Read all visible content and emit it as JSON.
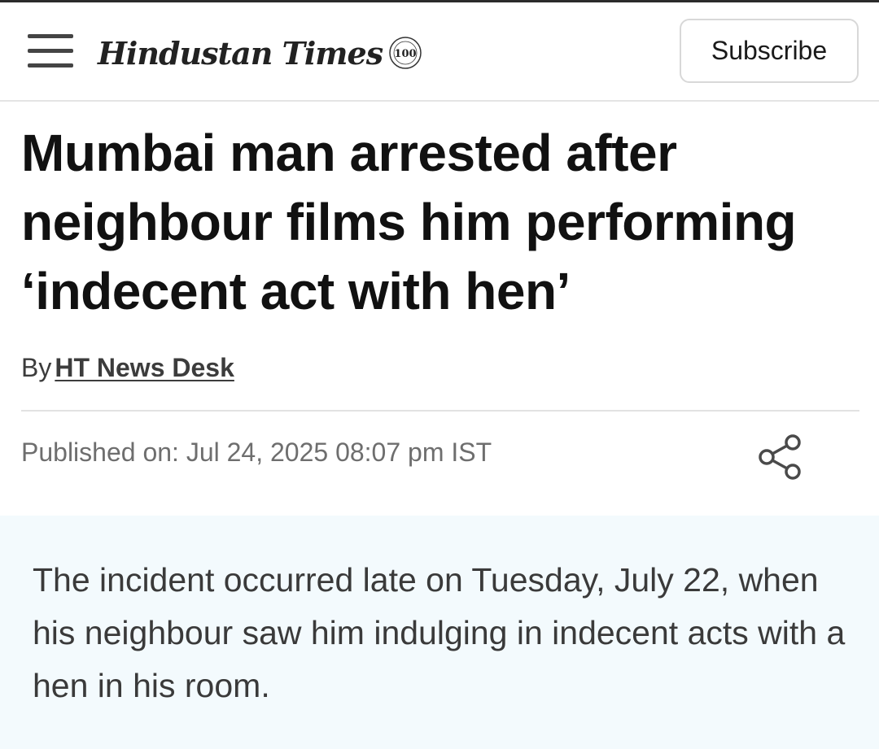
{
  "header": {
    "logo_text": "Hindustan Times",
    "logo_badge": "100",
    "subscribe_label": "Subscribe"
  },
  "article": {
    "headline": "Mumbai man arrested after neighbour films him performing ‘indecent act with hen’",
    "byline_prefix": "By",
    "author": "HT News Desk",
    "published": "Published on: Jul 24, 2025 08:07 pm IST",
    "summary": "The incident occurred late on Tuesday, July 22, when his neighbour saw him indulging in indecent acts with a hen in his room."
  },
  "icons": {
    "menu": "hamburger-menu-icon",
    "share": "share-icon"
  },
  "colors": {
    "summary_background": "#f3fafd",
    "published_text": "#6e6e6e"
  }
}
